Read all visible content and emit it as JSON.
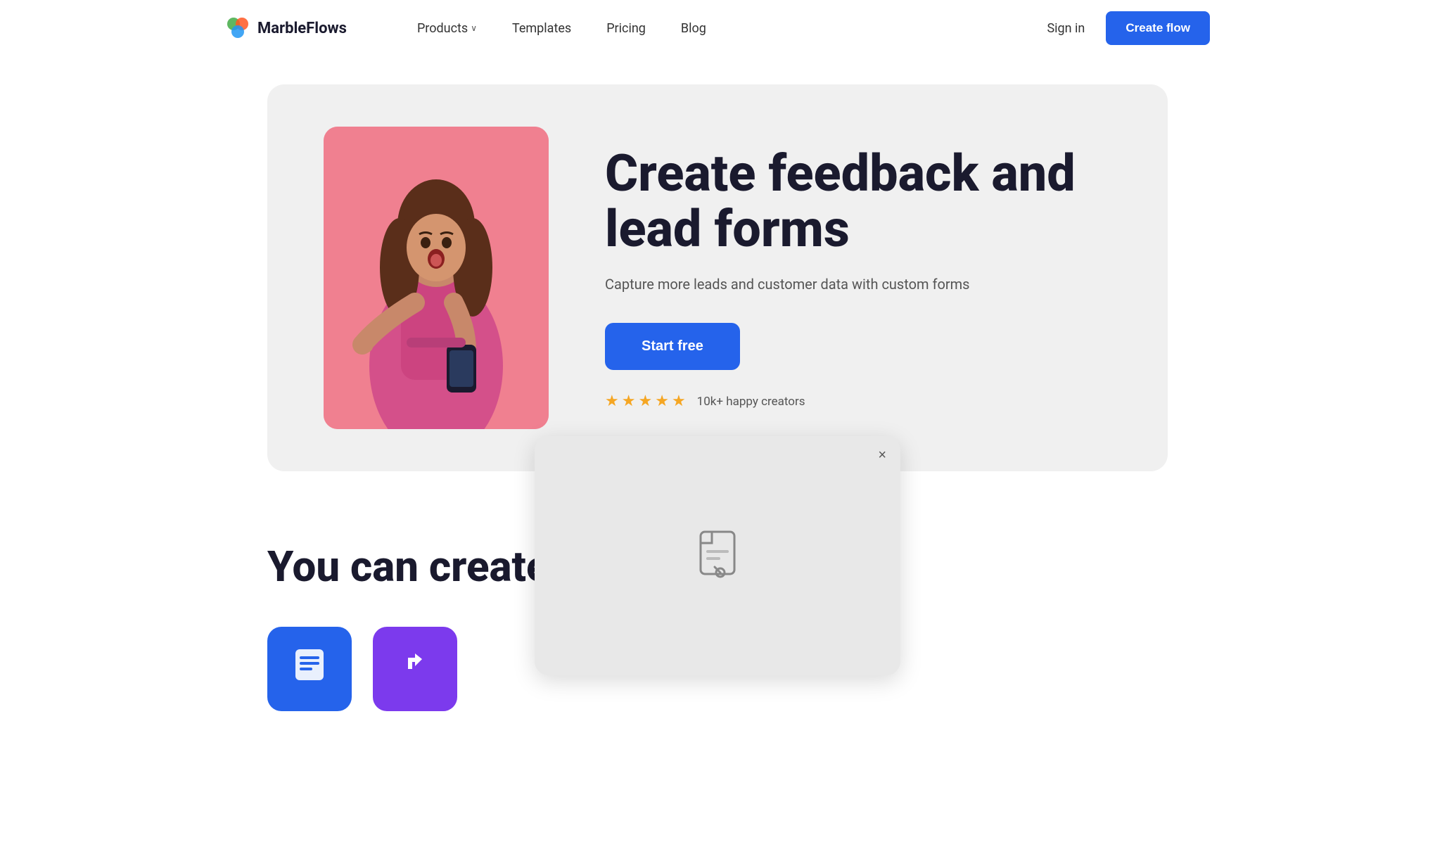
{
  "brand": {
    "name": "MarbleFlows",
    "logo_alt": "MarbleFlows logo"
  },
  "navbar": {
    "links": [
      {
        "label": "Products",
        "has_dropdown": true
      },
      {
        "label": "Templates",
        "has_dropdown": false
      },
      {
        "label": "Pricing",
        "has_dropdown": false
      },
      {
        "label": "Blog",
        "has_dropdown": false
      }
    ],
    "sign_in": "Sign in",
    "cta": "Create flow"
  },
  "hero": {
    "title": "Create feedback and lead forms",
    "subtitle": "Capture more leads and customer data with custom forms",
    "cta": "Start free",
    "rating": {
      "stars": 5,
      "label": "10k+ happy creators"
    }
  },
  "section": {
    "title_part1": "You can cre",
    "title_part2": "ate"
  },
  "modal": {
    "close_label": "×"
  },
  "icons": {
    "chevron": "›",
    "star": "★",
    "document": "🗋",
    "form_icon": "☰",
    "redirect_icon": "↩"
  }
}
